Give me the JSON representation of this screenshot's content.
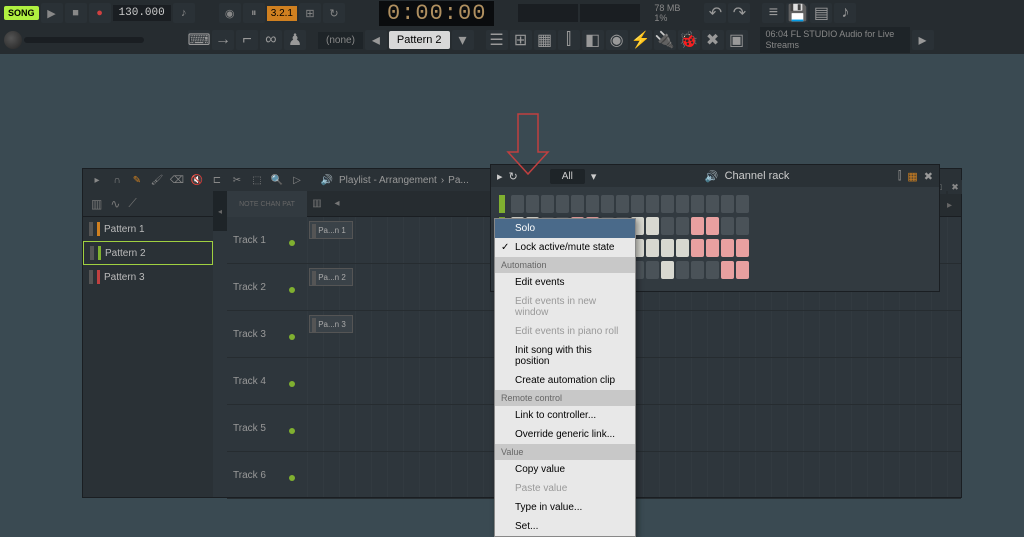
{
  "toolbar": {
    "song_mode": "SONG",
    "tempo": "130.000",
    "beat": "3.2.1",
    "time": "0:00:00",
    "memory": "78 MB",
    "cpu": "1%"
  },
  "second_toolbar": {
    "pattern_scope": "(none)",
    "pattern_name": "Pattern 2",
    "hint_time": "06:04",
    "hint_text": "FL STUDIO Audio for Live Streams"
  },
  "playlist": {
    "title": "Playlist - Arrangement",
    "breadcrumb": "Pa...",
    "track_header_label": "NOTE  CHAN  PAT",
    "patterns": [
      {
        "name": "Pattern 1",
        "color": "pc-orange"
      },
      {
        "name": "Pattern 2",
        "color": "pc-green"
      },
      {
        "name": "Pattern 3",
        "color": "pc-red"
      }
    ],
    "selected_pattern_index": 1,
    "tracks": [
      "Track 1",
      "Track 2",
      "Track 3",
      "Track 4",
      "Track 5",
      "Track 6"
    ],
    "clips": [
      {
        "track": 0,
        "label": "Pa...n 1"
      },
      {
        "track": 1,
        "label": "Pa...n 2"
      },
      {
        "track": 2,
        "label": "Pa...n 3"
      }
    ]
  },
  "channel_rack": {
    "title": "Channel rack",
    "filter": "All",
    "rows": [
      {
        "pattern": "0000000000000000"
      },
      {
        "pattern": "1100110011001100"
      },
      {
        "pattern": "1111111111111111"
      },
      {
        "pattern": "0011001100100011"
      }
    ]
  },
  "context_menu": {
    "sections": [
      {
        "items": [
          {
            "label": "Solo",
            "highlighted": true
          },
          {
            "label": "Lock active/mute state",
            "checked": true
          }
        ]
      },
      {
        "header": "Automation",
        "items": [
          {
            "label": "Edit events"
          },
          {
            "label": "Edit events in new window",
            "disabled": true
          },
          {
            "label": "Edit events in piano roll",
            "disabled": true
          },
          {
            "label": "Init song with this position"
          },
          {
            "label": "Create automation clip"
          }
        ]
      },
      {
        "header": "Remote control",
        "items": [
          {
            "label": "Link to controller..."
          },
          {
            "label": "Override generic link..."
          }
        ]
      },
      {
        "header": "Value",
        "items": [
          {
            "label": "Copy value"
          },
          {
            "label": "Paste value",
            "disabled": true
          },
          {
            "label": "Type in value..."
          },
          {
            "label": "Set..."
          }
        ]
      }
    ]
  }
}
